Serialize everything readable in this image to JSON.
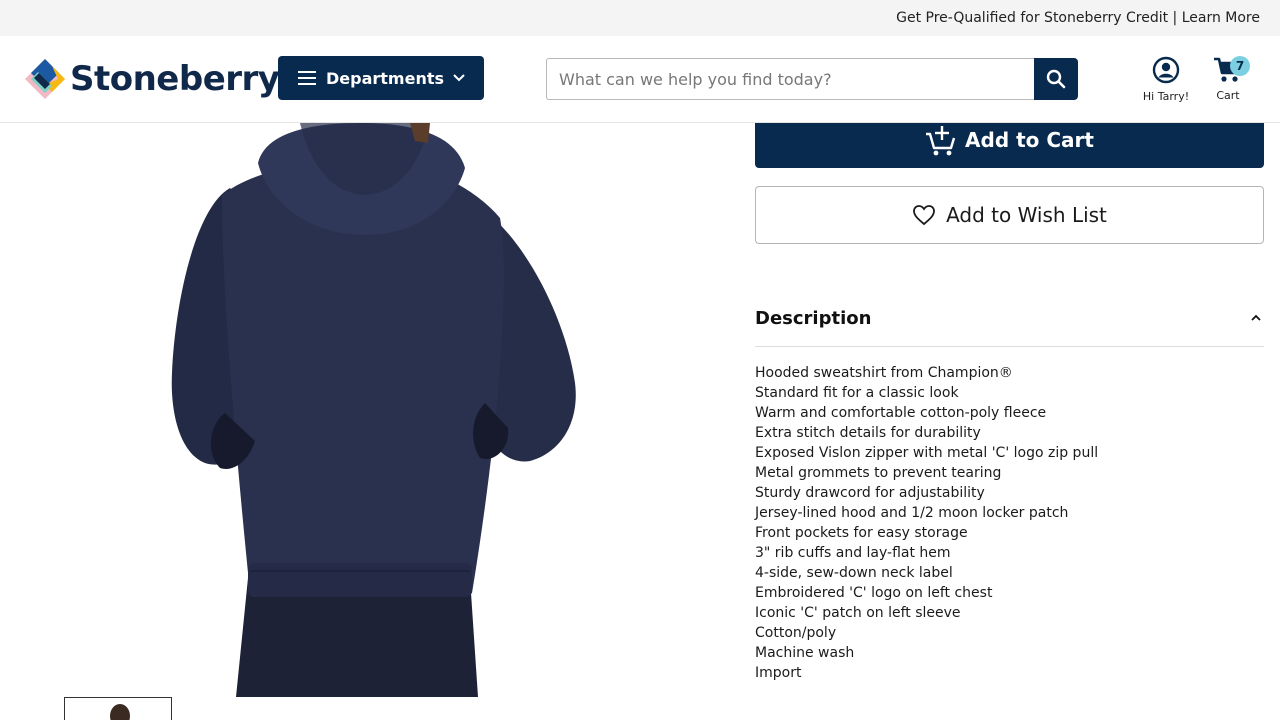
{
  "topbar": {
    "text": "Get Pre-Qualified for Stoneberry Credit | Learn More"
  },
  "header": {
    "logo_text": "Stoneberry",
    "departments_label": "Departments",
    "search_placeholder": "What can we help you find today?",
    "account_label": "Hi Tarry!",
    "cart_label": "Cart",
    "cart_count": "7"
  },
  "product": {
    "add_to_cart_label": "Add to Cart",
    "wishlist_label": "Add to Wish List",
    "description_title": "Description",
    "description_items": [
      "Hooded sweatshirt from Champion®",
      "Standard fit for a classic look",
      "Warm and comfortable cotton-poly fleece",
      "Extra stitch details for durability",
      "Exposed Vislon zipper with metal 'C' logo zip pull",
      "Metal grommets to prevent tearing",
      "Sturdy drawcord for adjustability",
      "Jersey-lined hood and 1/2 moon locker patch",
      "Front pockets for easy storage",
      "3\" rib cuffs and lay-flat hem",
      "4-side, sew-down neck label",
      "Embroidered 'C' logo on left chest",
      "Iconic 'C' patch on left sleeve",
      "Cotton/poly",
      "Machine wash",
      "Import"
    ]
  },
  "colors": {
    "brand_navy": "#082a4e",
    "badge_teal": "#7ccfe0",
    "topbar_bg": "#f4f4f4"
  },
  "icons": [
    "menu-icon",
    "chevron-down-icon",
    "search-icon",
    "account-icon",
    "cart-icon",
    "add-cart-icon",
    "heart-icon",
    "chevron-up-icon"
  ]
}
